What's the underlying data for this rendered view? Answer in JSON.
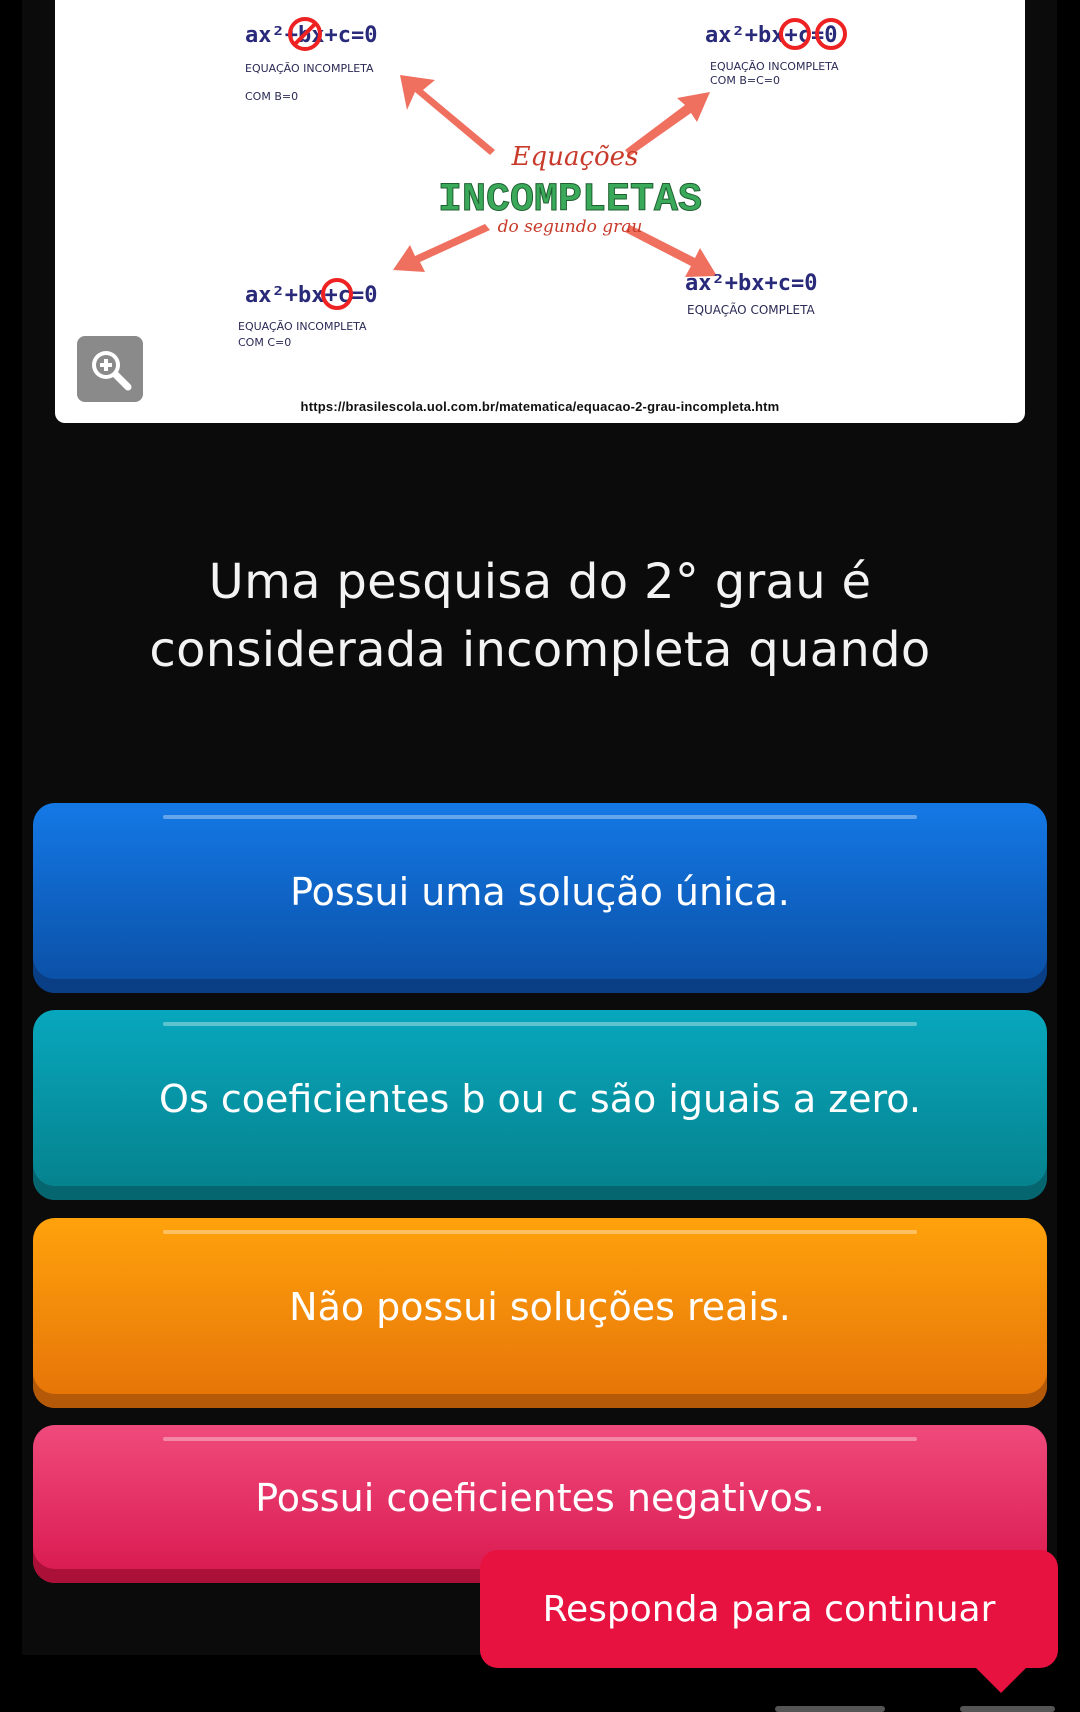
{
  "image": {
    "source_url": "https://brasilescola.uol.com.br/matematica/equacao-2-grau-incompleta.htm",
    "center_script": "Equações",
    "center_title": "INCOMPLETAS",
    "center_sub": "do segundo grau",
    "top_left": {
      "eq": "ax²+bx+c=0",
      "label1": "EQUAÇÃO INCOMPLETA",
      "label2": "COM B=0"
    },
    "top_right": {
      "eq": "ax²+bx+c=0",
      "label1": "EQUAÇÃO INCOMPLETA",
      "label2": "COM B=C=0"
    },
    "bottom_left": {
      "eq": "ax²+bx+c=0",
      "label1": "EQUAÇÃO INCOMPLETA",
      "label2": "COM C=0"
    },
    "bottom_right": {
      "eq": "ax²+bx+c=0",
      "label1": "EQUAÇÃO COMPLETA"
    }
  },
  "zoom_icon": "zoom-in-icon",
  "question": {
    "line1": "Uma pesquisa do 2° grau é",
    "line2": "considerada incompleta quando"
  },
  "answers": [
    {
      "label": "Possui uma solução única.",
      "color": "#1479e6"
    },
    {
      "label": "Os coeficientes b ou c são iguais a zero.",
      "color": "#08a7bd"
    },
    {
      "label": "Não possui soluções reais.",
      "color": "#ffa20c"
    },
    {
      "label": "Possui coeficientes negativos.",
      "color": "#f04a7c"
    }
  ],
  "toast": {
    "label": "Responda para continuar",
    "color": "#e81240"
  }
}
